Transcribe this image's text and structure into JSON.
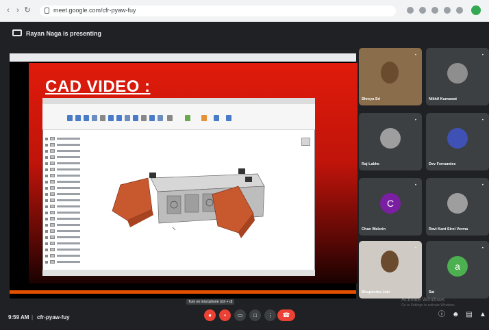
{
  "browser": {
    "url": "meet.google.com/cfr-pyaw-fuy"
  },
  "meet": {
    "presenting_text": "Rayan Naga is presenting",
    "meeting_code": "cfr-pyaw-fuy",
    "time": "9:59 AM",
    "separator": "|",
    "tooltip": "Turn on microphone (ctrl + d)"
  },
  "slide": {
    "title": "CAD VIDEO :"
  },
  "participants": [
    {
      "name": "Shreya Sri",
      "initial": "",
      "color": "#5f6368"
    },
    {
      "name": "Nikhil Kumawat",
      "initial": "",
      "color": "#8e8e8e"
    },
    {
      "name": "Raj Lakhe",
      "initial": "",
      "color": "#9e9e9e"
    },
    {
      "name": "Dev Fernandes",
      "initial": "",
      "color": "#3f51b5"
    },
    {
      "name": "Chan Walsrin",
      "initial": "C",
      "color": "#7b1fa2"
    },
    {
      "name": "Ravi Kant Siroi Verma",
      "initial": "",
      "color": "#9e9e9e"
    },
    {
      "name": "Bhupendra Jain",
      "initial": "",
      "color": "#6b6d6f"
    },
    {
      "name": "Sai",
      "initial": "a",
      "color": "#4caf50"
    }
  ],
  "watermark": {
    "line1": "Activate Windows",
    "line2": "Go to Settings to activate Windows."
  },
  "colors": {
    "end_call": "#ea4335",
    "seekbar": "#e65100",
    "slide_red": "#e01b0b"
  },
  "icons": [
    "lock-icon",
    "present-icon",
    "mic-off-icon",
    "camera-off-icon",
    "captions-icon",
    "present-now-icon",
    "more-icon",
    "end-call-icon",
    "info-icon",
    "people-icon",
    "chat-icon",
    "activities-icon"
  ]
}
